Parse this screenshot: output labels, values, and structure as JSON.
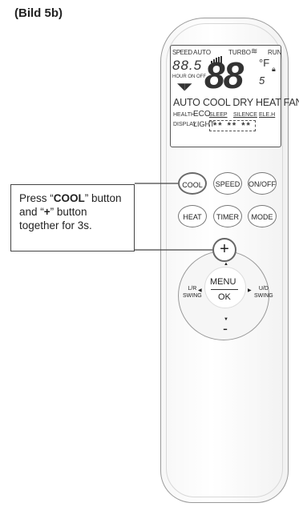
{
  "caption": "(Bild 5b)",
  "lcd": {
    "speed": "SPEED",
    "auto_top": "AUTO",
    "turbo": "TURBO",
    "run": "RUN",
    "small_digits": "88.5",
    "hour_onoff": "HOUR ON OFF",
    "big_digits": "88",
    "deg_unit": "°F",
    "tiny5": "5",
    "modes": "AUTO COOL DRY HEAT FAN",
    "health": "HEALTH",
    "eco": "ECO",
    "sleep": "SLEEP",
    "silence": "SILENCE",
    "eleh": "ELE.H",
    "display": "DISPLAY",
    "light": "LIGHT",
    "stars": "** ** **"
  },
  "buttons": {
    "cool": "COOL",
    "speed": "SPEED",
    "onoff": "ON/OFF",
    "heat": "HEAT",
    "timer": "TIMER",
    "mode": "MODE",
    "plus": "+",
    "minus": "-",
    "menu": "MENU",
    "ok": "OK",
    "lr_1": "L/R",
    "lr_2": "SWING",
    "ud_1": "U/D",
    "ud_2": "SWING"
  },
  "callout": {
    "l1_pre": "Press “",
    "l1_bold": "COOL",
    "l1_post": "” button",
    "l2_pre": "and “",
    "l2_bold": "+",
    "l2_post": "” button",
    "l3": "together for 3s."
  }
}
